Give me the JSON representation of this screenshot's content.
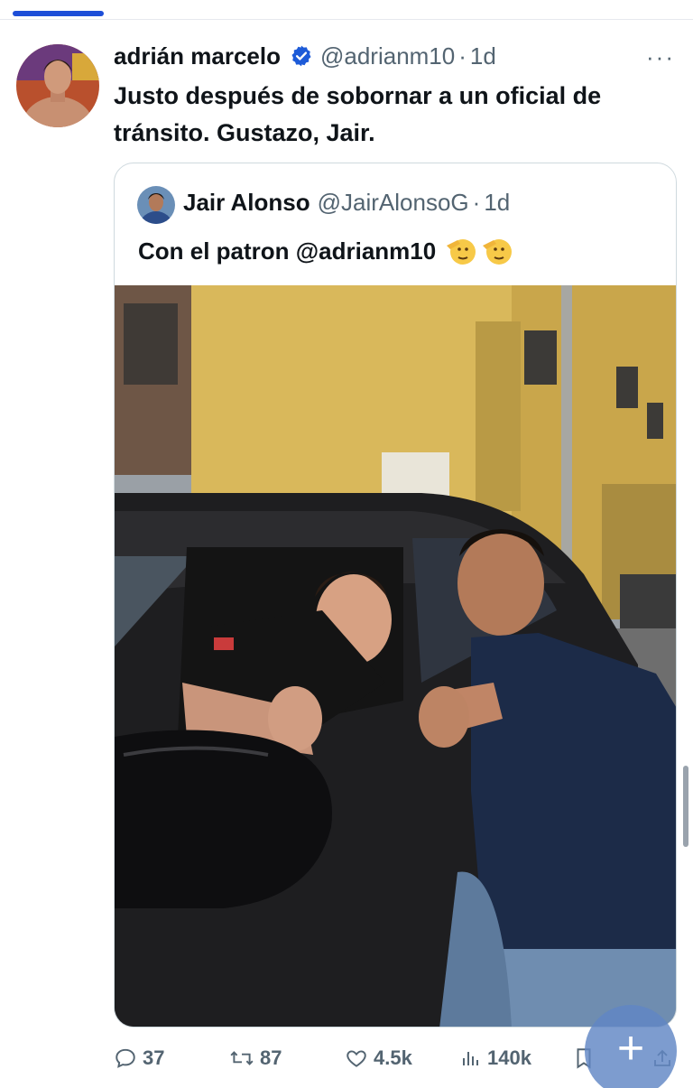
{
  "post": {
    "author_name": "adrián marcelo",
    "author_handle": "@adrianm10",
    "separator": "·",
    "time": "1d",
    "more_label": "···",
    "text": "Justo después de sobornar a un oficial de tránsito. Gustazo, Jair.",
    "verified_icon": "verified-badge-icon",
    "colors": {
      "verified": "#1d5bd8",
      "accent": "#1d4ed8",
      "muted": "#536471"
    }
  },
  "quote": {
    "author_name": "Jair Alonso",
    "author_handle": "@JairAlonsoG",
    "separator": "·",
    "time": "1d",
    "text": "Con el patron @adrianm10",
    "emoji": [
      "saluting-face-emoji",
      "saluting-face-emoji"
    ]
  },
  "actions": {
    "replies": "37",
    "reposts": "87",
    "likes": "4.5k",
    "views": "140k",
    "icons": [
      "reply-icon",
      "repost-icon",
      "like-icon",
      "views-icon",
      "bookmark-icon",
      "share-icon"
    ]
  },
  "fab": {
    "label": "+"
  }
}
